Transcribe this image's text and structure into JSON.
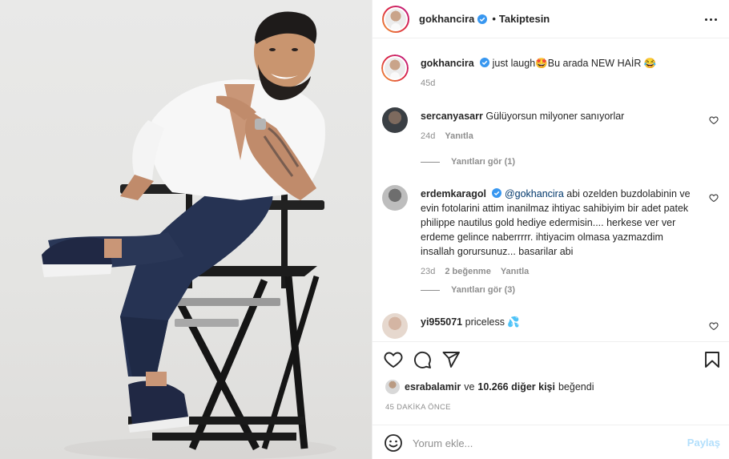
{
  "post": {
    "author": "gokhancira",
    "follow_state": "Takiptesin",
    "more_icon": "more-horizontal-icon"
  },
  "caption": {
    "username": "gokhancira",
    "text": "just laugh🤩Bu arada NEW HAİR 😂",
    "age": "45d"
  },
  "comments": [
    {
      "username": "sercanyasarr",
      "text": "Gülüyorsun milyoner sanıyorlar",
      "age": "24d",
      "reply_label": "Yanıtla",
      "view_replies": "Yanıtları gör (1)"
    },
    {
      "username": "erdemkaragol",
      "mention": "@gokhancira",
      "text": "abi ozelden buzdolabinin ve evin fotolarini attim inanilmaz ihtiyac sahibiyim bir adet patek philippe nautilus gold hediye edermisin.... herkese ver ver erdeme gelince naberrrrr. ihtiyacim olmasa yazmazdim insallah gorursunuz... basarilar abi",
      "age": "23d",
      "likes": "2 beğenme",
      "reply_label": "Yanıtla",
      "view_replies": "Yanıtları gör (3)"
    },
    {
      "username": "yi955071",
      "text": "priceless 💦"
    }
  ],
  "liked_by": {
    "user": "esrabalamir",
    "connector": "ve",
    "others": "10.266 diğer kişi",
    "suffix": "beğendi"
  },
  "timestamp": "45 DAKİKA ÖNCE",
  "add_comment": {
    "placeholder": "Yorum ekle...",
    "submit_label": "Paylaş"
  },
  "icons": {
    "like": "heart-icon",
    "comment": "comment-icon",
    "share": "send-icon",
    "save": "bookmark-icon",
    "emoji": "emoji-icon"
  },
  "colors": {
    "verified": "#3897f0",
    "link": "#00376b",
    "share_disabled": "#b2dffc",
    "secondary_text": "#8e8e8e"
  }
}
